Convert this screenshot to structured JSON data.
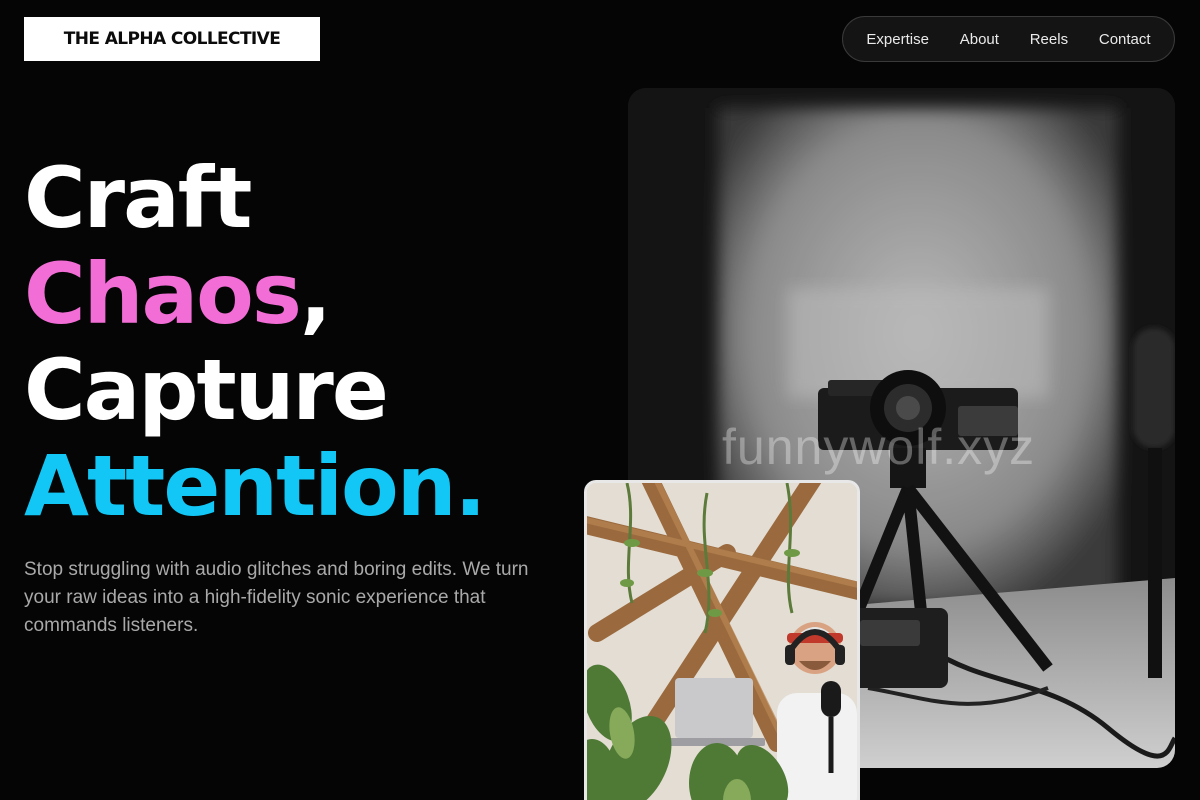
{
  "header": {
    "logo_text": "THE ALPHA COLLECTIVE",
    "nav": [
      "Expertise",
      "About",
      "Reels",
      "Contact"
    ]
  },
  "hero": {
    "headline": {
      "line1": "Craft",
      "line2_word": "Chaos",
      "line2_punct": ",",
      "line3": "Capture",
      "line4": "Attention."
    },
    "subtext": "Stop struggling with audio glitches and boring edits. We turn your raw ideas into a high-fidelity sonic experience that commands listeners.",
    "watermark": "funnywolf.xyz"
  },
  "colors": {
    "background": "#050505",
    "accent_pink": "#f26ed6",
    "accent_cyan": "#12c7f5"
  }
}
